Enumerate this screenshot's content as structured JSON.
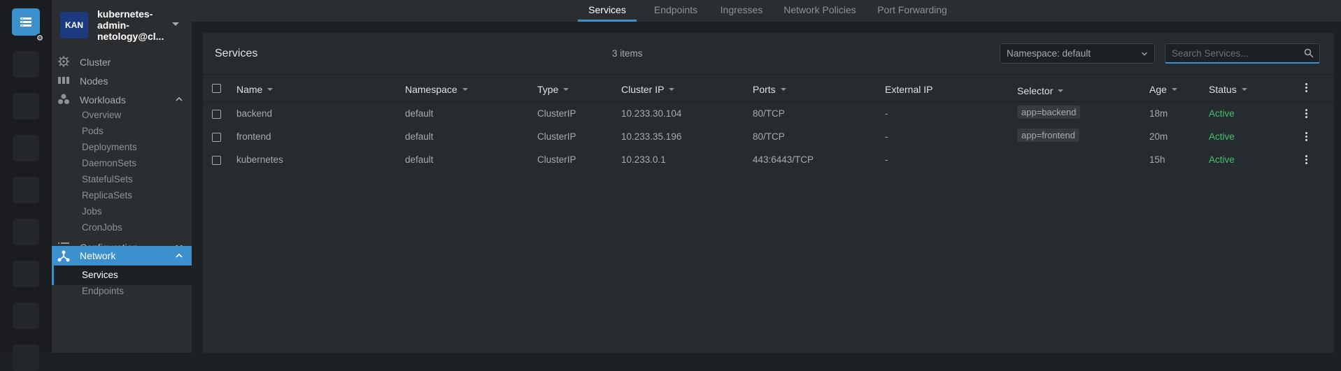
{
  "cluster": {
    "initials": "KAN",
    "name": "kubernetes-admin-netology@cl..."
  },
  "sidebar": {
    "items": [
      {
        "label": "Cluster",
        "icon": "helm-icon"
      },
      {
        "label": "Nodes",
        "icon": "nodes-icon"
      },
      {
        "label": "Workloads",
        "icon": "workloads-icon",
        "expanded": true
      },
      {
        "label": "Configuration",
        "icon": "list-icon",
        "expanded": false
      },
      {
        "label": "Network",
        "icon": "network-icon",
        "expanded": true,
        "active": true
      }
    ],
    "workloads_sub": [
      "Overview",
      "Pods",
      "Deployments",
      "DaemonSets",
      "StatefulSets",
      "ReplicaSets",
      "Jobs",
      "CronJobs"
    ],
    "network_sub": [
      "Services",
      "Endpoints"
    ]
  },
  "tabs": [
    "Services",
    "Endpoints",
    "Ingresses",
    "Network Policies",
    "Port Forwarding"
  ],
  "active_tab": "Services",
  "panel": {
    "title": "Services",
    "count": "3 items",
    "namespace_select": "Namespace: default",
    "search_placeholder": "Search Services..."
  },
  "table": {
    "headers": [
      "Name",
      "Namespace",
      "Type",
      "Cluster IP",
      "Ports",
      "External IP",
      "Selector",
      "Age",
      "Status"
    ],
    "rows": [
      {
        "name": "backend",
        "namespace": "default",
        "type": "ClusterIP",
        "cluster_ip": "10.233.30.104",
        "ports": "80/TCP",
        "external_ip": "-",
        "selector": "app=backend",
        "age": "18m",
        "status": "Active"
      },
      {
        "name": "frontend",
        "namespace": "default",
        "type": "ClusterIP",
        "cluster_ip": "10.233.35.196",
        "ports": "80/TCP",
        "external_ip": "-",
        "selector": "app=frontend",
        "age": "20m",
        "status": "Active"
      },
      {
        "name": "kubernetes",
        "namespace": "default",
        "type": "ClusterIP",
        "cluster_ip": "10.233.0.1",
        "ports": "443:6443/TCP",
        "external_ip": "-",
        "selector": "",
        "age": "15h",
        "status": "Active"
      }
    ]
  },
  "colors": {
    "accent": "#3d90ce",
    "active_status": "#48c16e",
    "cluster_badge": "#1c3a80"
  }
}
